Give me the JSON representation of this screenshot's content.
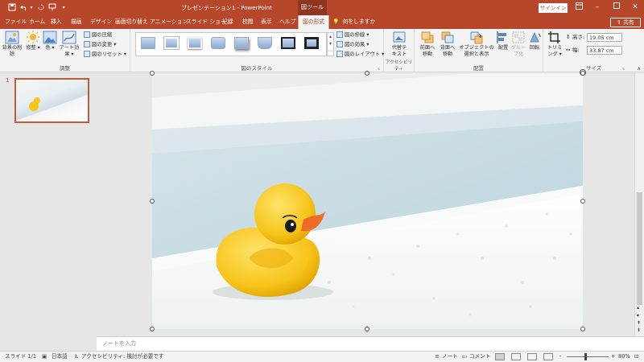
{
  "titlebar": {
    "title": "プレゼンテーション1 - PowerPoint",
    "context_tab": "図ツール",
    "signin": "サインイン",
    "quick_access": [
      "save-icon",
      "undo-icon",
      "redo-icon",
      "presenter-icon",
      "customize-icon"
    ],
    "window_controls": [
      "ribbon-display-icon",
      "minimize-icon",
      "maximize-icon",
      "close-icon"
    ]
  },
  "tabs": [
    {
      "label": "ファイル"
    },
    {
      "label": "ホーム"
    },
    {
      "label": "挿入"
    },
    {
      "label": "描画"
    },
    {
      "label": "デザイン"
    },
    {
      "label": "画面切り替え"
    },
    {
      "label": "アニメーション"
    },
    {
      "label": "スライド ショー"
    },
    {
      "label": "記録"
    },
    {
      "label": "校閲"
    },
    {
      "label": "表示"
    },
    {
      "label": "ヘルプ"
    },
    {
      "label": "図の形式",
      "active": true
    }
  ],
  "tell_me": "何をしますか",
  "share": "共有",
  "ribbon": {
    "adjust": {
      "label": "調整",
      "remove_bg": "背景の削除",
      "corrections": "修整",
      "color": "色",
      "artistic": "アート効果",
      "compress": "図の圧縮",
      "change": "図の変更",
      "reset": "図のリセット"
    },
    "styles": {
      "label": "図のスタイル",
      "border": "図の枠線",
      "effects": "図の効果",
      "layout": "図のレイアウト"
    },
    "accessibility": {
      "label": "アクセシビリティ",
      "alt_text_line1": "代替テ",
      "alt_text_line2": "キスト"
    },
    "arrange": {
      "label": "配置",
      "bring_forward_line1": "前面へ",
      "bring_forward_line2": "移動",
      "send_backward_line1": "背面へ",
      "send_backward_line2": "移動",
      "selection_pane_line1": "オブジェクトの",
      "selection_pane_line2": "選択と表示",
      "align": "配置",
      "group": "グループ化",
      "rotate": "回転"
    },
    "size": {
      "label": "サイズ",
      "crop": "トリミング",
      "height_label": "高さ:",
      "height_value": "19.05 cm",
      "width_label": "幅:",
      "width_value": "33.87 cm"
    }
  },
  "slides_panel": {
    "slide_number": "1"
  },
  "notes": {
    "placeholder": "ノートを入力"
  },
  "status": {
    "slide": "スライド 1/1",
    "language": "日本語",
    "accessibility": "アクセシビリティ: 検討が必要です",
    "notes": "ノート",
    "comments": "コメント",
    "zoom_minus": "-",
    "zoom_plus": "+",
    "zoom": "80%"
  },
  "colors": {
    "accent": "#b7472a",
    "accent_dark": "#8f3621",
    "ribbon_bg": "#f3f3f3",
    "duck_yellow": "#f7c51b",
    "beak_orange": "#f06a28"
  }
}
